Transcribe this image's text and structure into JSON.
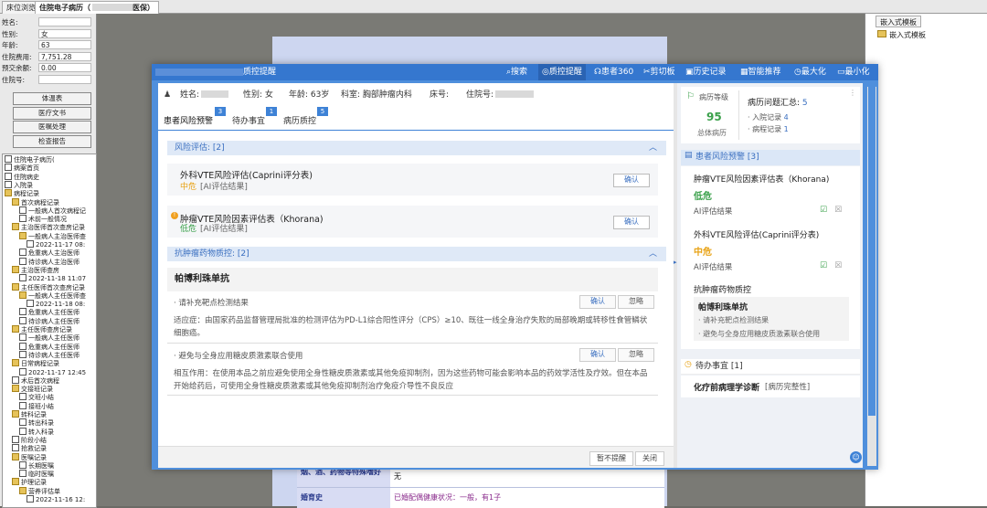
{
  "topbar": {
    "tab_ward": "床位浏览",
    "tab_emr": "住院电子病历（",
    "tab_emr_tail": "医保）"
  },
  "left": {
    "fields": [
      {
        "label": "姓名:",
        "value": "",
        "masked": true
      },
      {
        "label": "性别:",
        "value": "女"
      },
      {
        "label": "年龄:",
        "value": "63"
      },
      {
        "label": "住院费用:",
        "value": "7,751.28"
      },
      {
        "label": "预交余额:",
        "value": "0.00"
      },
      {
        "label": "住院号:",
        "value": ""
      }
    ],
    "buttons": [
      "体温表",
      "医疗文书",
      "医嘱处理",
      "检查报告"
    ],
    "tree": [
      {
        "t": "住院电子病历(",
        "lvl": 0
      },
      {
        "t": "病案首页",
        "lvl": 0
      },
      {
        "t": "住院病史",
        "lvl": 0
      },
      {
        "t": "入院录",
        "lvl": 0
      },
      {
        "t": "病程记录",
        "lvl": 0,
        "f": 1
      },
      {
        "t": "首次病程记录",
        "lvl": 1,
        "f": 1
      },
      {
        "t": "一般病人首次病程记",
        "lvl": 2
      },
      {
        "t": "术前一般情况",
        "lvl": 2
      },
      {
        "t": "主治医师首次查房记录",
        "lvl": 1,
        "f": 1
      },
      {
        "t": "一般病人主治医师查",
        "lvl": 2,
        "f": 1
      },
      {
        "t": "2022-11-17 08:",
        "lvl": 3
      },
      {
        "t": "危重病人主治医师",
        "lvl": 2
      },
      {
        "t": "待诊病人主治医师",
        "lvl": 2
      },
      {
        "t": "主治医师查房",
        "lvl": 1,
        "f": 1
      },
      {
        "t": "2022-11-18 11:07",
        "lvl": 2
      },
      {
        "t": "主任医师首次查房记录",
        "lvl": 1,
        "f": 1
      },
      {
        "t": "一般病人主任医师查",
        "lvl": 2,
        "f": 1
      },
      {
        "t": "2022-11-18 08:",
        "lvl": 3
      },
      {
        "t": "危重病人主任医师",
        "lvl": 2
      },
      {
        "t": "待诊病人主任医师",
        "lvl": 2
      },
      {
        "t": "主任医师查房记录",
        "lvl": 1,
        "f": 1
      },
      {
        "t": "一般病人主任医师",
        "lvl": 2
      },
      {
        "t": "危重病人主任医师",
        "lvl": 2
      },
      {
        "t": "待诊病人主任医师",
        "lvl": 2
      },
      {
        "t": "日常病程记录",
        "lvl": 1,
        "f": 1
      },
      {
        "t": "2022-11-17 12:45",
        "lvl": 2
      },
      {
        "t": "术后首次病程",
        "lvl": 1
      },
      {
        "t": "交接班记录",
        "lvl": 1,
        "f": 1
      },
      {
        "t": "交班小结",
        "lvl": 2
      },
      {
        "t": "接班小结",
        "lvl": 2
      },
      {
        "t": "转科记录",
        "lvl": 1,
        "f": 1
      },
      {
        "t": "转出科录",
        "lvl": 2
      },
      {
        "t": "转入科录",
        "lvl": 2
      },
      {
        "t": "阶段小结",
        "lvl": 1
      },
      {
        "t": "抢救记录",
        "lvl": 1
      },
      {
        "t": "医嘱记录",
        "lvl": 1,
        "f": 1
      },
      {
        "t": "长期医嘱",
        "lvl": 2
      },
      {
        "t": "临时医嘱",
        "lvl": 2
      },
      {
        "t": "护理记录",
        "lvl": 1,
        "f": 1
      },
      {
        "t": "营养评估单",
        "lvl": 2,
        "f": 1
      },
      {
        "t": "2022-11-16 12:",
        "lvl": 3
      }
    ]
  },
  "doc": {
    "rows": [
      {
        "k": "烟、酒、药物等特殊嗜好",
        "v": "无"
      },
      {
        "k": "婚育史",
        "v": "已婚配偶健康状况：一般，有1子"
      }
    ]
  },
  "right_panel": {
    "tab": "嵌入式模板",
    "item": "嵌入式模板"
  },
  "dialog": {
    "title": "质控提醒",
    "toolbar": [
      "搜索",
      "质控提醒",
      "患者360",
      "剪切板",
      "历史记录",
      "智能推荐",
      "最大化",
      "最小化"
    ],
    "patient": {
      "name_label": "姓名:",
      "sex_label": "性别:",
      "sex": "女",
      "age_label": "年龄:",
      "age": "63岁",
      "dept_label": "科室:",
      "dept": "胸部肿瘤内科",
      "bed_label": "床号:",
      "inpatient_label": "住院号:"
    },
    "subtabs": [
      {
        "label": "患者风险预警",
        "badge": "3"
      },
      {
        "label": "待办事宜",
        "badge": "1"
      },
      {
        "label": "病历质控",
        "badge": "5"
      }
    ],
    "risk_section": "风险评估: [2]",
    "risk_items": [
      {
        "title": "外科VTE风险评估(Caprini评分表)",
        "level": "中危",
        "level_color": "#e8a317",
        "ai": "[AI评估结果]",
        "confirm": "确认"
      },
      {
        "title": "肿瘤VTE风险因素评估表（Khorana)",
        "level": "低危",
        "level_color": "#3aa04a",
        "ai": "[AI评估结果]",
        "confirm": "确认"
      }
    ],
    "drug_section": "抗肿瘤药物质控: [2]",
    "drug_name": "帕博利珠单抗",
    "drug_items": [
      {
        "line": "· 请补充靶点检测结果",
        "confirm": "确认",
        "ignore": "忽略",
        "detail": "适应症：由国家药品监督管理局批准的检测评估为PD-L1综合阳性评分（CPS）≥10、既往一线全身治疗失败的局部晚期或转移性食管鳞状细胞癌。"
      },
      {
        "line": "· 避免与全身应用糖皮质激素联合使用",
        "confirm": "确认",
        "ignore": "忽略",
        "detail": "相互作用：在使用本品之前应避免使用全身性糖皮质激素或其他免疫抑制剂，因为这些药物可能会影响本品的药效学活性及疗效。但在本品开始给药后，可使用全身性糖皮质激素或其他免疫抑制剂治疗免疫介导性不良反应"
      }
    ],
    "footer": {
      "snooze": "暂不提醒",
      "close": "关闭"
    },
    "side": {
      "grade_label": "病历等级",
      "grade_score": "95",
      "grade_sub": "总体病历",
      "summary_label": "病历问题汇总:",
      "summary_count": "5",
      "summary_items": [
        {
          "label": "· 入院记录",
          "n": "4"
        },
        {
          "label": "· 病程记录",
          "n": "1"
        }
      ],
      "risk_head": "患者风险预警 [3]",
      "risks": [
        {
          "title": "肿瘤VTE风险因素评估表（Khorana)",
          "level": "低危",
          "level_color": "#3aa04a",
          "ai": "AI评估结果"
        },
        {
          "title": "外科VTE风险评估(Caprini评分表)",
          "level": "中危",
          "level_color": "#e8a317",
          "ai": "AI评估结果"
        }
      ],
      "drug_head": "抗肿瘤药物质控",
      "drug_name": "帕博利珠单抗",
      "drug_lines": [
        "· 请补充靶点检测结果",
        "· 避免与全身应用糖皮质激素联合使用"
      ],
      "todo_head": "待办事宜 [1]",
      "todo_item": "化疗前病理学诊断",
      "todo_tag": "[病历完整性]"
    }
  }
}
